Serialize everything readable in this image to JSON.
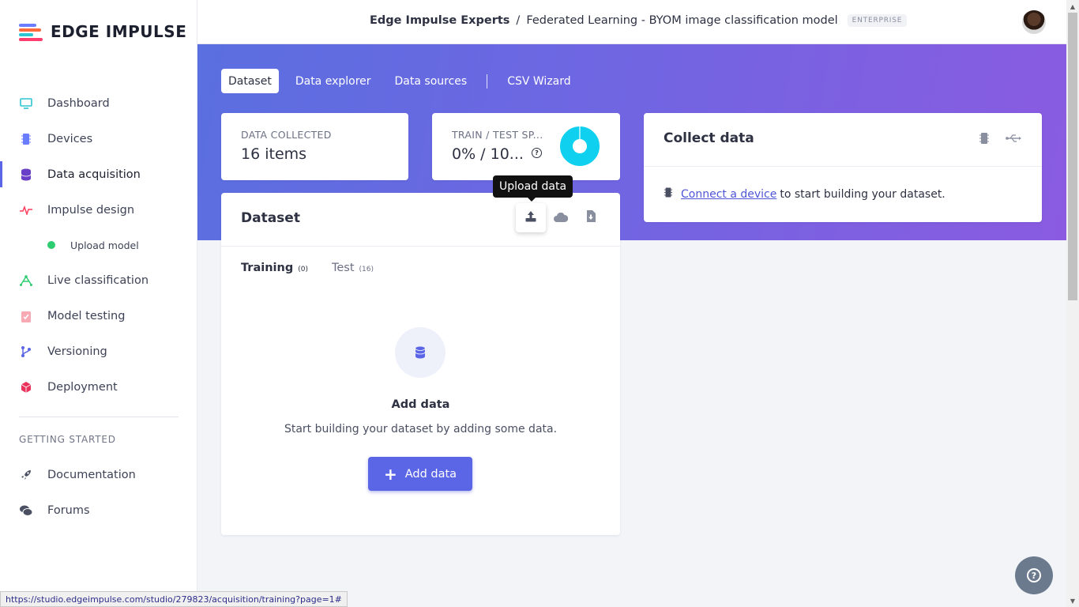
{
  "app": {
    "logo_text": "EDGE IMPULSE"
  },
  "sidebar": {
    "items": [
      {
        "label": "Dashboard",
        "icon": "monitor-icon"
      },
      {
        "label": "Devices",
        "icon": "chip-icon"
      },
      {
        "label": "Data acquisition",
        "icon": "database-icon",
        "active": true
      },
      {
        "label": "Impulse design",
        "icon": "pulse-icon"
      },
      {
        "label": "Upload model",
        "icon": "green-dot-icon",
        "sub": true
      },
      {
        "label": "Live classification",
        "icon": "network-icon"
      },
      {
        "label": "Model testing",
        "icon": "clipboard-check-icon"
      },
      {
        "label": "Versioning",
        "icon": "branch-icon"
      },
      {
        "label": "Deployment",
        "icon": "cube-icon"
      }
    ],
    "section_title": "GETTING STARTED",
    "getting_started": [
      {
        "label": "Documentation",
        "icon": "rocket-icon"
      },
      {
        "label": "Forums",
        "icon": "chat-icon"
      }
    ]
  },
  "header": {
    "org": "Edge Impulse Experts",
    "separator": "/",
    "project": "Federated Learning - BYOM image classification model",
    "badge": "ENTERPRISE"
  },
  "tabs": [
    "Dataset",
    "Data explorer",
    "Data sources",
    "CSV Wizard"
  ],
  "stats": {
    "collected_label": "DATA COLLECTED",
    "collected_value": "16 items",
    "split_label": "TRAIN / TEST SP...",
    "split_value": "0% / 10...",
    "split_train_fraction": 0.0
  },
  "collect": {
    "title": "Collect data",
    "link": "Connect a device",
    "text": "to start building your dataset."
  },
  "dataset": {
    "title": "Dataset",
    "tooltip": "Upload data",
    "training_label": "Training",
    "training_count": "(0)",
    "test_label": "Test",
    "test_count": "(16)",
    "empty_title": "Add data",
    "empty_sub": "Start building your dataset by adding some data.",
    "add_button": "Add data"
  },
  "status_url": "https://studio.edgeimpulse.com/studio/279823/acquisition/training?page=1#",
  "colors": {
    "accent": "#5b66e6",
    "pie": "#0fd0ef"
  }
}
